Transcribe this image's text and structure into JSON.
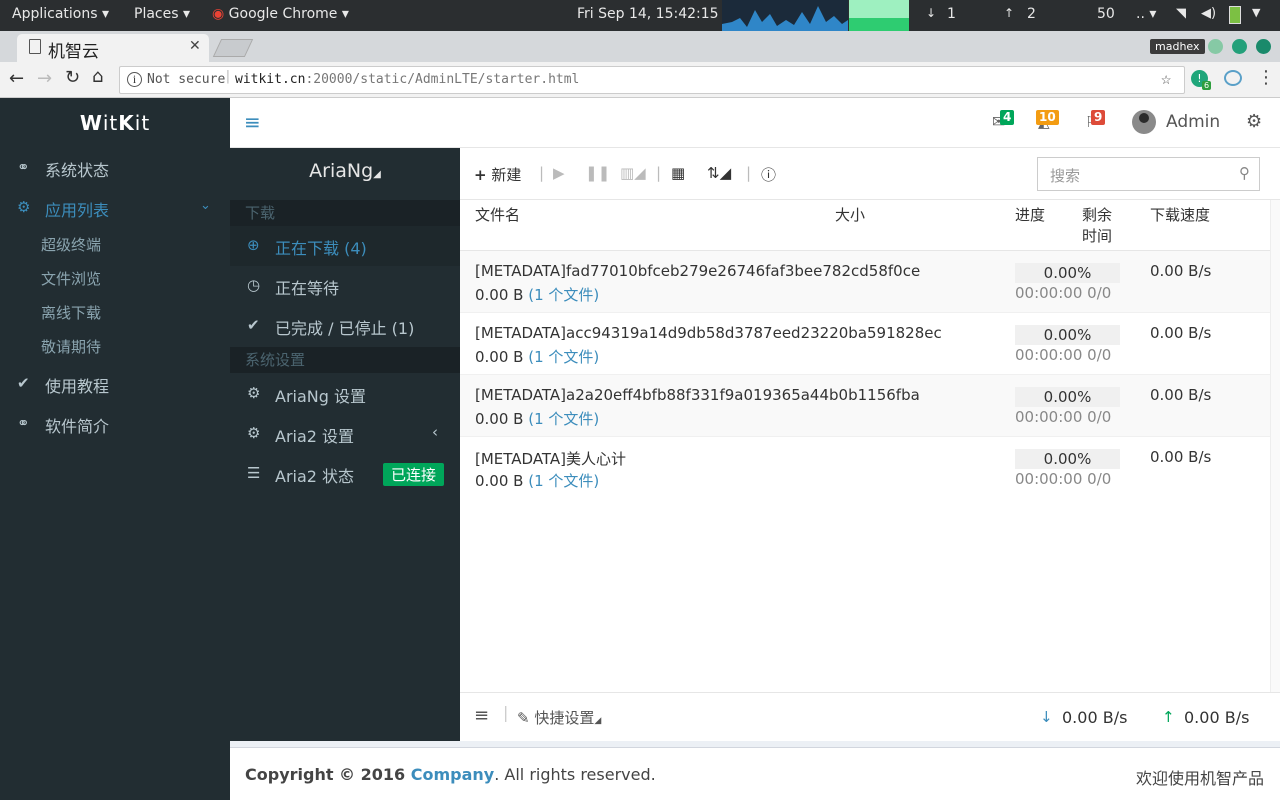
{
  "os": {
    "applications": "Applications",
    "places": "Places",
    "chrome": "Google Chrome",
    "clock": "Fri Sep 14, 15:42:15",
    "net_down": "1",
    "net_up": "2",
    "net_misc": "50",
    "ellipsis": ".."
  },
  "browser": {
    "tab_title": "机智云",
    "profile": "madhex",
    "security": "Not secure",
    "url_host": "witkit.cn",
    "url_rest": ":20000/static/AdminLTE/starter.html",
    "ext_badge": "6"
  },
  "sidebar": {
    "logo_a": "W",
    "logo_b": "it",
    "logo_c": "K",
    "logo_d": "it",
    "items": [
      {
        "label": "系统状态"
      },
      {
        "label": "应用列表"
      },
      {
        "label": "使用教程"
      },
      {
        "label": "软件简介"
      }
    ],
    "subitems": [
      {
        "label": "超级终端"
      },
      {
        "label": "文件浏览"
      },
      {
        "label": "离线下载"
      },
      {
        "label": "敬请期待"
      }
    ]
  },
  "header": {
    "mail_count": "4",
    "notif_count": "10",
    "flag_count": "9",
    "user": "Admin"
  },
  "aria": {
    "title": "AriaNg",
    "section_download": "下载",
    "downloading": "正在下载 (4)",
    "waiting": "正在等待",
    "stopped": "已完成 / 已停止 (1)",
    "section_settings": "系统设置",
    "ariang_settings": "AriaNg 设置",
    "aria2_settings": "Aria2 设置",
    "aria2_status": "Aria2 状态",
    "connected": "已连接"
  },
  "toolbar": {
    "new": "新建",
    "search_placeholder": "搜索"
  },
  "table": {
    "headers": {
      "name": "文件名",
      "size": "大小",
      "progress": "进度",
      "remaining_a": "剩余",
      "remaining_b": "时间",
      "speed": "下载速度"
    },
    "rows": [
      {
        "name": "[METADATA]fad77010bfceb279e26746faf3bee782cd58f0ce",
        "size": "0.00 B",
        "files": "(1 个文件)",
        "progress": "0.00%",
        "remaining": "00:00:00",
        "conn": "0/0",
        "speed": "0.00 B/s"
      },
      {
        "name": "[METADATA]acc94319a14d9db58d3787eed23220ba591828ec",
        "size": "0.00 B",
        "files": "(1 个文件)",
        "progress": "0.00%",
        "remaining": "00:00:00",
        "conn": "0/0",
        "speed": "0.00 B/s"
      },
      {
        "name": "[METADATA]a2a20eff4bfb88f331f9a019365a44b0b1156fba",
        "size": "0.00 B",
        "files": "(1 个文件)",
        "progress": "0.00%",
        "remaining": "00:00:00",
        "conn": "0/0",
        "speed": "0.00 B/s"
      },
      {
        "name": "[METADATA]美人心计",
        "size": "0.00 B",
        "files": "(1 个文件)",
        "progress": "0.00%",
        "remaining": "00:00:00",
        "conn": "0/0",
        "speed": "0.00 B/s"
      }
    ]
  },
  "footer": {
    "quick_settings": "快捷设置",
    "down_speed": "0.00 B/s",
    "up_speed": "0.00 B/s"
  },
  "page_footer": {
    "copyright": "Copyright © 2016",
    "company": "Company",
    "rights": ". All rights reserved.",
    "welcome": "欢迎使用机智产品"
  },
  "colors": {
    "accent": "#3c8dbc",
    "success": "#00a65a",
    "warning": "#f39c12",
    "danger": "#dd4b39"
  }
}
